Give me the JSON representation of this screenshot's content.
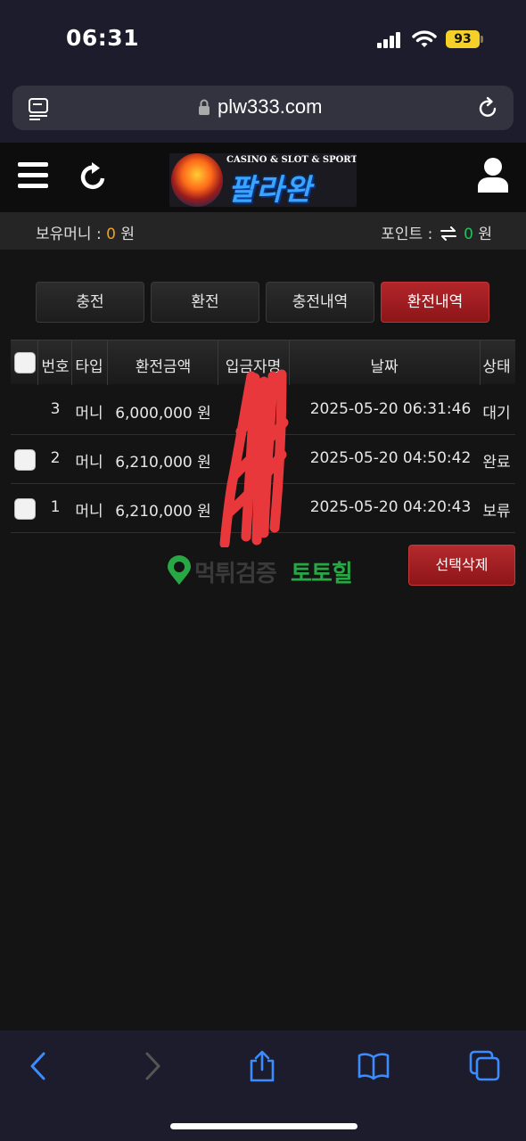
{
  "status_bar": {
    "time": "06:31",
    "battery": "93"
  },
  "browser": {
    "url": "plw333.com"
  },
  "header": {
    "logo_tagline": "CASINO & SLOT & SPORTS",
    "logo_name": "팔라완"
  },
  "balance": {
    "money_label": "보유머니 :",
    "money_value": "0",
    "money_unit": "원",
    "points_label": "포인트 :",
    "points_value": "0",
    "points_unit": "원"
  },
  "tabs": [
    {
      "label": "충전",
      "active": false
    },
    {
      "label": "환전",
      "active": false
    },
    {
      "label": "충전내역",
      "active": false
    },
    {
      "label": "환전내역",
      "active": true
    }
  ],
  "table": {
    "headers": [
      "번호",
      "타입",
      "환전금액",
      "입금자명",
      "날짜",
      "상태"
    ],
    "rows": [
      {
        "num": "3",
        "type": "머니",
        "amount": "6,000,000 원",
        "name": "",
        "date": "2025-05-20 06:31:46",
        "status": "대기",
        "has_checkbox": false
      },
      {
        "num": "2",
        "type": "머니",
        "amount": "6,210,000 원",
        "name": "",
        "date": "2025-05-20 04:50:42",
        "status": "완료",
        "has_checkbox": true
      },
      {
        "num": "1",
        "type": "머니",
        "amount": "6,210,000 원",
        "name": "",
        "date": "2025-05-20 04:20:43",
        "status": "보류",
        "has_checkbox": true
      }
    ]
  },
  "actions": {
    "delete_label": "선택삭제"
  },
  "watermark": {
    "gray": "먹튀검증",
    "green": "토토힐"
  },
  "colors": {
    "accent_red": "#a81e22",
    "money_orange": "#f0a020",
    "points_green": "#22c05a",
    "redaction": "#e8383c"
  }
}
